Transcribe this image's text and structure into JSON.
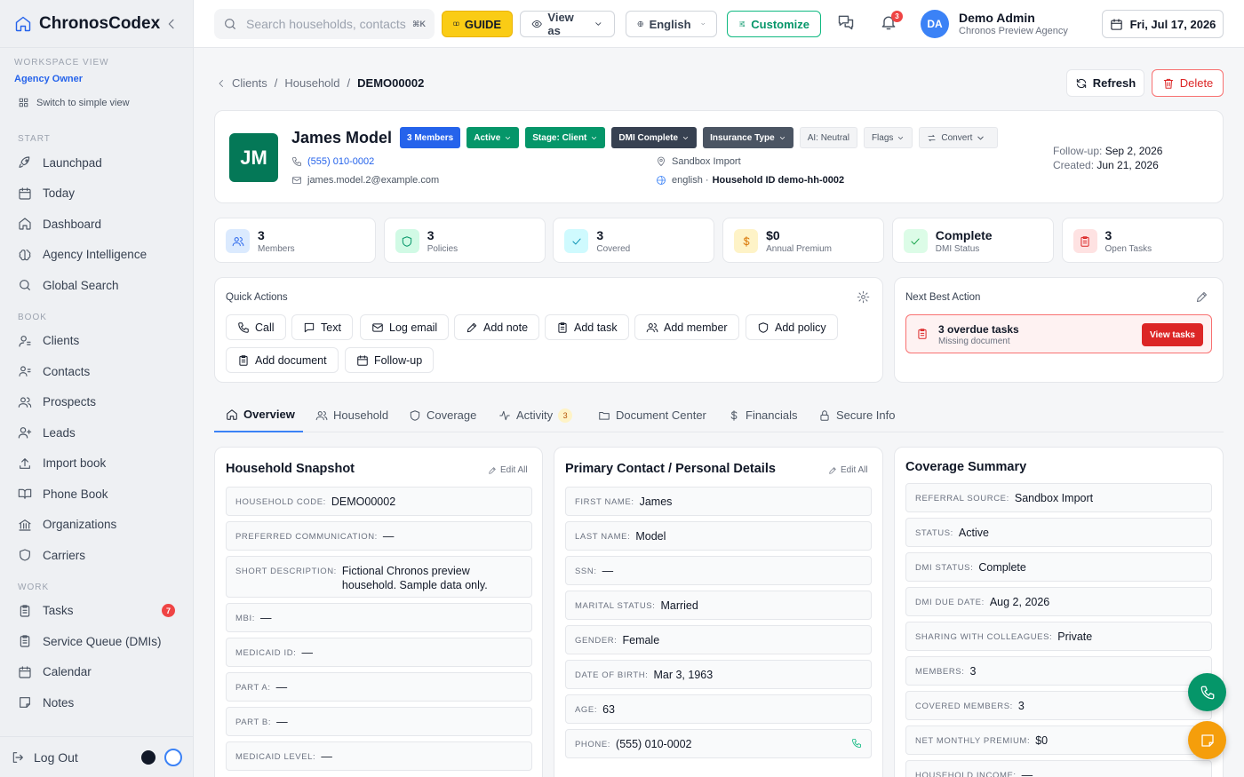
{
  "app": {
    "name": "ChronosCodex"
  },
  "workspace": {
    "label": "WORKSPACE VIEW",
    "role": "Agency Owner",
    "switch": "Switch to simple view"
  },
  "sidebar": {
    "sections": [
      {
        "title": "START",
        "items": [
          {
            "label": "Launchpad",
            "icon": "rocket-icon"
          },
          {
            "label": "Today",
            "icon": "calendar-icon"
          },
          {
            "label": "Dashboard",
            "icon": "home-icon"
          },
          {
            "label": "Agency Intelligence",
            "icon": "brain-icon"
          },
          {
            "label": "Global Search",
            "icon": "search-icon"
          }
        ]
      },
      {
        "title": "BOOK",
        "items": [
          {
            "label": "Clients",
            "icon": "user-icon"
          },
          {
            "label": "Contacts",
            "icon": "contacts-icon"
          },
          {
            "label": "Prospects",
            "icon": "users-icon"
          },
          {
            "label": "Leads",
            "icon": "user-plus-icon"
          },
          {
            "label": "Import book",
            "icon": "upload-icon"
          },
          {
            "label": "Phone Book",
            "icon": "book-icon"
          },
          {
            "label": "Organizations",
            "icon": "bank-icon"
          },
          {
            "label": "Carriers",
            "icon": "shield-icon"
          }
        ]
      },
      {
        "title": "WORK",
        "items": [
          {
            "label": "Tasks",
            "icon": "clipboard-icon",
            "badge": "7"
          },
          {
            "label": "Service Queue (DMIs)",
            "icon": "clipboard-icon"
          },
          {
            "label": "Calendar",
            "icon": "calendar-icon"
          },
          {
            "label": "Notes",
            "icon": "note-icon"
          }
        ]
      }
    ],
    "logout": "Log Out"
  },
  "header": {
    "search_placeholder": "Search households, contacts",
    "search_kbd": "⌘K",
    "guide": "GUIDE",
    "view_as": "View as",
    "language": "English",
    "customize": "Customize",
    "notif_count": "3",
    "user_initials": "DA",
    "user_name": "Demo Admin",
    "user_org": "Chronos Preview Agency",
    "date": "Fri, Jul 17, 2026"
  },
  "breadcrumb": {
    "items": [
      "Clients",
      "Household"
    ],
    "current": "DEMO00002"
  },
  "actions": {
    "refresh": "Refresh",
    "delete": "Delete"
  },
  "profile": {
    "initials": "JM",
    "name": "James Model",
    "chips": {
      "members": "3 Members",
      "active": "Active",
      "stage": "Stage: Client",
      "dmi": "DMI Complete",
      "insurance": "Insurance Type",
      "ai": "AI: Neutral",
      "flags": "Flags",
      "convert": "Convert"
    },
    "phone": "(555) 010-0002",
    "email": "james.model.2@example.com",
    "source": "Sandbox Import",
    "language": "english ·",
    "household_id": "Household ID demo-hh-0002",
    "followup_label": "Follow-up:",
    "followup": "Sep 2, 2026",
    "created_label": "Created:",
    "created": "Jun 21, 2026"
  },
  "stats": [
    {
      "value": "3",
      "label": "Members",
      "icon": "users-icon",
      "bg": "#dbeafe",
      "fg": "#2563eb"
    },
    {
      "value": "3",
      "label": "Policies",
      "icon": "shield-icon",
      "bg": "#d1fae5",
      "fg": "#059669"
    },
    {
      "value": "3",
      "label": "Covered",
      "icon": "check-icon",
      "bg": "#cffafe",
      "fg": "#0891b2"
    },
    {
      "value": "$0",
      "label": "Annual Premium",
      "icon": "dollar-icon",
      "bg": "#fef3c7",
      "fg": "#d97706"
    },
    {
      "value": "Complete",
      "label": "DMI Status",
      "icon": "check-icon",
      "bg": "#dcfce7",
      "fg": "#16a34a"
    },
    {
      "value": "3",
      "label": "Open Tasks",
      "icon": "clipboard-icon",
      "bg": "#fee2e2",
      "fg": "#dc2626"
    }
  ],
  "quick_actions": {
    "title": "Quick Actions",
    "buttons": [
      "Call",
      "Text",
      "Log email",
      "Add note",
      "Add task",
      "Add member",
      "Add policy",
      "Add document",
      "Follow-up"
    ]
  },
  "next_best_action": {
    "title": "Next Best Action",
    "alert_title": "3 overdue tasks",
    "alert_sub": "Missing document",
    "alert_button": "View tasks"
  },
  "tabs": [
    {
      "label": "Overview"
    },
    {
      "label": "Household"
    },
    {
      "label": "Coverage"
    },
    {
      "label": "Activity",
      "count": "3"
    },
    {
      "label": "Document Center"
    },
    {
      "label": "Financials"
    },
    {
      "label": "Secure Info"
    }
  ],
  "household_snapshot": {
    "title": "Household Snapshot",
    "edit": "Edit All",
    "fields": [
      {
        "label": "Household code:",
        "value": "DEMO00002"
      },
      {
        "label": "Preferred communication:",
        "value": "—"
      },
      {
        "label": "Short description:",
        "value": "Fictional Chronos preview household. Sample data only."
      },
      {
        "label": "MBI:",
        "value": "—"
      },
      {
        "label": "Medicaid ID:",
        "value": "—"
      },
      {
        "label": "Part A:",
        "value": "—"
      },
      {
        "label": "Part B:",
        "value": "—"
      },
      {
        "label": "Medicaid level:",
        "value": "—"
      }
    ]
  },
  "primary_contact": {
    "title": "Primary Contact / Personal Details",
    "edit": "Edit All",
    "fields": [
      {
        "label": "First name:",
        "value": "James"
      },
      {
        "label": "Last name:",
        "value": "Model"
      },
      {
        "label": "SSN:",
        "value": "—"
      },
      {
        "label": "Marital status:",
        "value": "Married"
      },
      {
        "label": "Gender:",
        "value": "Female"
      },
      {
        "label": "Date of birth:",
        "value": "Mar 3, 1963"
      },
      {
        "label": "Age:",
        "value": "63"
      },
      {
        "label": "Phone:",
        "value": "(555) 010-0002"
      }
    ]
  },
  "coverage_summary": {
    "title": "Coverage Summary",
    "fields": [
      {
        "label": "Referral source:",
        "value": "Sandbox Import"
      },
      {
        "label": "Status:",
        "value": "Active"
      },
      {
        "label": "DMI status:",
        "value": "Complete"
      },
      {
        "label": "DMI due date:",
        "value": "Aug 2, 2026"
      },
      {
        "label": "Sharing with colleagues:",
        "value": "Private"
      },
      {
        "label": "Members:",
        "value": "3"
      },
      {
        "label": "Covered members:",
        "value": "3"
      },
      {
        "label": "Net monthly premium:",
        "value": "$0"
      },
      {
        "label": "Household income:",
        "value": "—"
      }
    ]
  },
  "colors": {
    "accent": "#2563eb",
    "brand_green": "#047857",
    "danger": "#dc2626",
    "guide": "#facc15"
  }
}
